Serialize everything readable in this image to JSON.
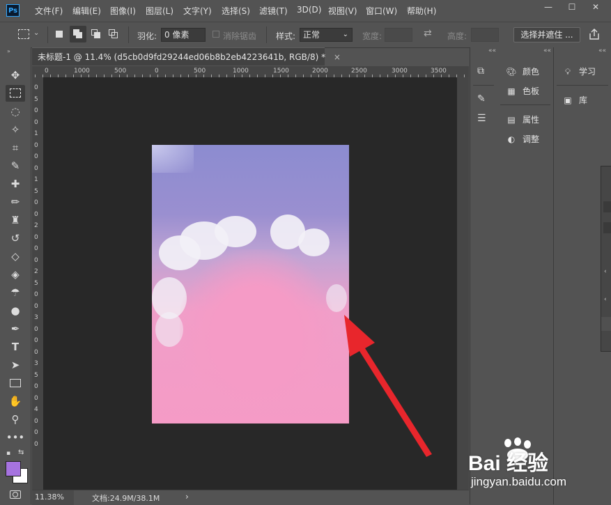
{
  "menubar": {
    "logo": "Ps",
    "items": [
      "文件(F)",
      "编辑(E)",
      "图像(I)",
      "图层(L)",
      "文字(Y)",
      "选择(S)",
      "滤镜(T)",
      "3D(D)",
      "视图(V)",
      "窗口(W)",
      "帮助(H)"
    ],
    "window_controls": [
      "—",
      "☐",
      "✕"
    ]
  },
  "options": {
    "feather_label": "羽化:",
    "feather_value": "0 像素",
    "antialias_label": "消除锯齿",
    "style_label": "样式:",
    "style_value": "正常",
    "width_label": "宽度:",
    "height_label": "高度:",
    "select_mask_button": "选择并遮住 ..."
  },
  "document": {
    "tab_title": "未标题-1 @ 11.4% (d5cb0d9fd29244ed06b8b2eb4223641b, RGB/8) *",
    "tab_close": "×",
    "ruler_h_ticks": [
      "0",
      "1000",
      "500",
      "0",
      "500",
      "1000",
      "1500",
      "2000",
      "2500",
      "3000",
      "3500"
    ],
    "ruler_v_ticks": [
      "0",
      "5",
      "0",
      "0",
      "1",
      "0",
      "0",
      "0",
      "1",
      "5",
      "0",
      "0",
      "2",
      "0",
      "0",
      "0",
      "2",
      "5",
      "0",
      "0",
      "3",
      "0",
      "0",
      "0",
      "3",
      "5",
      "0",
      "0",
      "4",
      "0",
      "0",
      "0"
    ]
  },
  "status": {
    "zoom": "11.38%",
    "doc_info": "文档:24.9M/38.1M",
    "arrow": "›"
  },
  "panels": {
    "mid": [
      {
        "icon": "palette-icon",
        "label": "颜色"
      },
      {
        "icon": "grid-icon",
        "label": "色板"
      },
      {
        "icon": "properties-icon",
        "label": "属性"
      },
      {
        "icon": "adjustments-icon",
        "label": "调整"
      }
    ],
    "right": [
      {
        "icon": "lightbulb-icon",
        "label": "学习"
      },
      {
        "icon": "library-icon",
        "label": "库"
      }
    ]
  },
  "colors": {
    "foreground": "#a673e0",
    "background": "#ffffff",
    "arrow": "#e8262c"
  },
  "watermark": {
    "brand": "Bai 经验",
    "url": "jingyan.baidu.com"
  }
}
